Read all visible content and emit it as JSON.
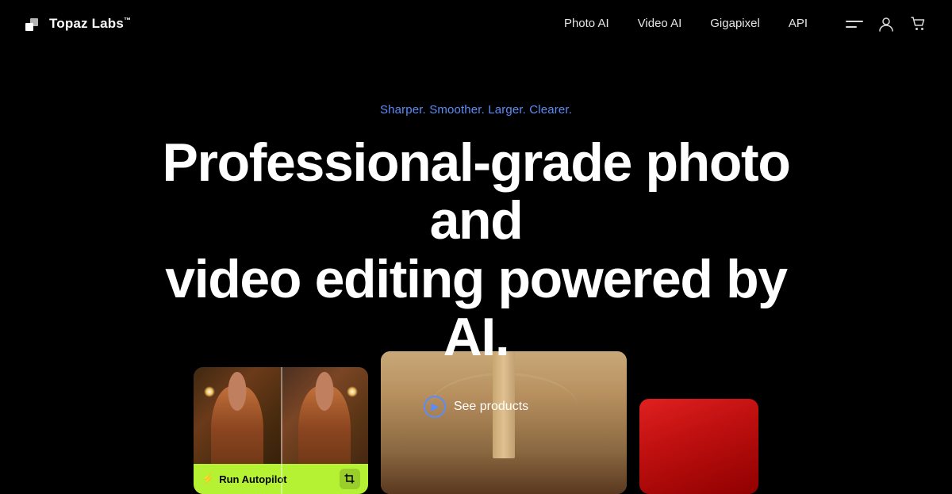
{
  "brand": {
    "logo_text": "Topaz Labs",
    "tm_symbol": "™"
  },
  "nav": {
    "links": [
      {
        "label": "Photo AI",
        "href": "#"
      },
      {
        "label": "Video AI",
        "href": "#"
      },
      {
        "label": "Gigapixel",
        "href": "#"
      },
      {
        "label": "API",
        "href": "#"
      }
    ]
  },
  "hero": {
    "tagline": "Sharper. Smoother. Larger. Clearer.",
    "title_line1": "Professional-grade photo and",
    "title_line2": "video editing powered by AI.",
    "cta_label": "See products"
  },
  "preview": {
    "autopilot_label": "Run Autopilot"
  },
  "colors": {
    "accent_blue": "#5b8cf8",
    "accent_green": "#b5f233",
    "bg": "#000000"
  }
}
